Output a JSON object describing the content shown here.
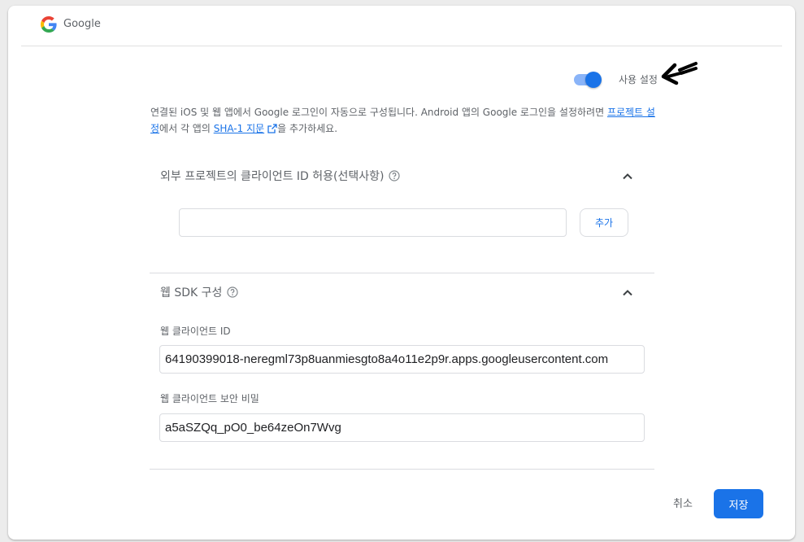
{
  "provider": {
    "name": "Google",
    "icon": "google-g-icon"
  },
  "toggle": {
    "label": "사용 설정",
    "enabled": true,
    "accent": "#1a73e8"
  },
  "description": {
    "part1": "연결된 iOS 및 웹 앱에서 Google 로그인이 자동으로 구성됩니다. Android 앱의 Google 로그인을 설정하려면 ",
    "link_project_settings": "프로젝트 설정",
    "part2": "에서 각 앱의 ",
    "link_sha1": "SHA-1 지문",
    "part3": "을 추가하세요."
  },
  "whitelist_section": {
    "title": "외부 프로젝트의 클라이언트 ID 허용(선택사항)",
    "input_value": "",
    "add_label": "추가"
  },
  "web_sdk_section": {
    "title": "웹 SDK 구성",
    "client_id_label": "웹 클라이언트 ID",
    "client_id_value": "64190399018-neregml73p8uanmiesgto8a4o11e2p9r.apps.googleusercontent.com",
    "client_secret_label": "웹 클라이언트 보안 비밀",
    "client_secret_value": "a5aSZQq_pO0_be64zeOn7Wvg"
  },
  "actions": {
    "cancel_label": "취소",
    "save_label": "저장"
  },
  "colors": {
    "primary": "#1a73e8",
    "primary_light": "#8ab4f8",
    "text_secondary": "#5f6368"
  }
}
